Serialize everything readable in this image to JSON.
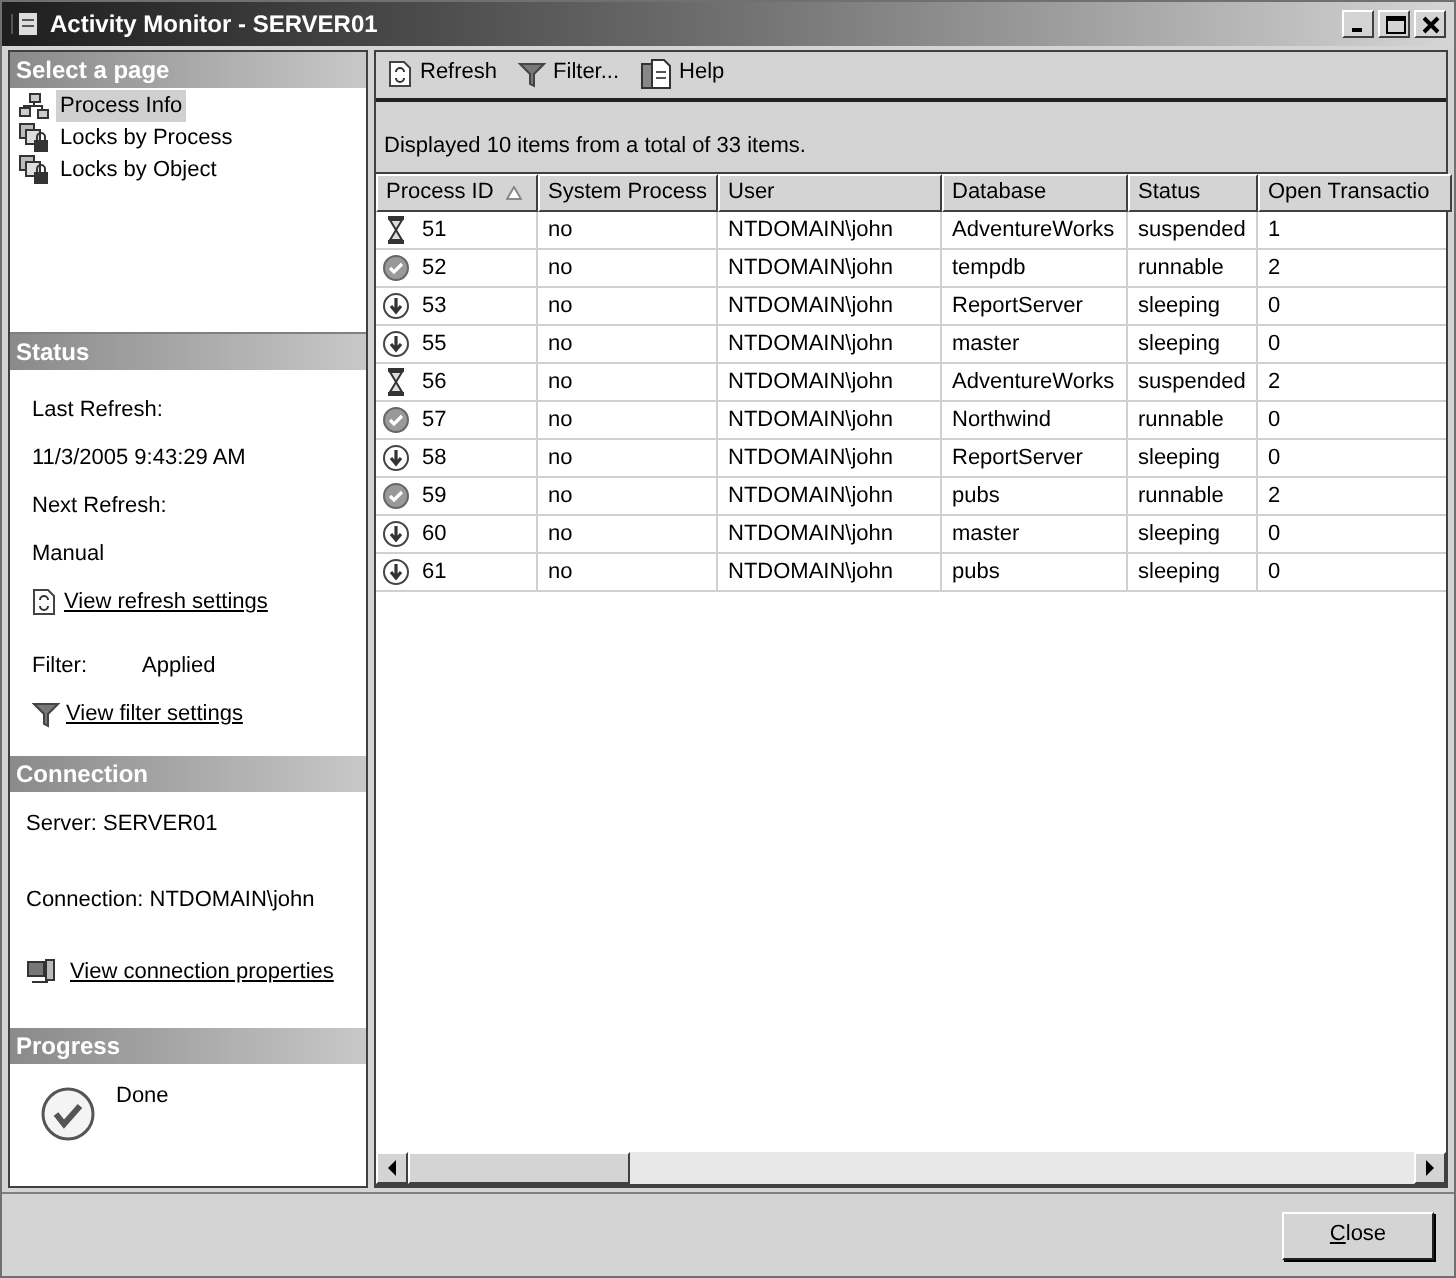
{
  "window": {
    "title": "Activity Monitor - SERVER01"
  },
  "select_page": {
    "title": "Select a page",
    "items": [
      {
        "label": "Process Info",
        "kind": "process",
        "selected": true
      },
      {
        "label": "Locks by Process",
        "kind": "locks",
        "selected": false
      },
      {
        "label": "Locks by Object",
        "kind": "locks",
        "selected": false
      }
    ]
  },
  "status": {
    "title": "Status",
    "last_refresh_label": "Last Refresh:",
    "last_refresh": "11/3/2005 9:43:29 AM",
    "next_refresh_label": "Next Refresh:",
    "next_refresh": "Manual",
    "refresh_link": "View refresh settings",
    "filter_label": "Filter:",
    "filter_value": "Applied",
    "filter_link": "View filter settings"
  },
  "connection": {
    "title": "Connection",
    "server": "Server: SERVER01",
    "connection": "Connection: NTDOMAIN\\john",
    "link": "View connection properties"
  },
  "progress": {
    "title": "Progress",
    "text": "Done"
  },
  "toolbar": [
    {
      "label": "Refresh",
      "kind": "refresh"
    },
    {
      "label": "Filter...",
      "kind": "filter"
    },
    {
      "label": "Help",
      "kind": "help"
    }
  ],
  "info": "Displayed 10 items from a total of 33 items.",
  "table": {
    "columns": [
      {
        "label": "Process ID",
        "sorted": true
      },
      {
        "label": "System Process",
        "sorted": false
      },
      {
        "label": "User",
        "sorted": false
      },
      {
        "label": "Database",
        "sorted": false
      },
      {
        "label": "Status",
        "sorted": false
      },
      {
        "label": "Open Transactio",
        "sorted": false
      }
    ],
    "rows": [
      {
        "kind": "suspended",
        "cells": [
          "51",
          "no",
          "NTDOMAIN\\john",
          "AdventureWorks",
          "suspended",
          "1"
        ]
      },
      {
        "kind": "runnable",
        "cells": [
          "52",
          "no",
          "NTDOMAIN\\john",
          "tempdb",
          "runnable",
          "2"
        ]
      },
      {
        "kind": "sleeping",
        "cells": [
          "53",
          "no",
          "NTDOMAIN\\john",
          "ReportServer",
          "sleeping",
          "0"
        ]
      },
      {
        "kind": "sleeping",
        "cells": [
          "55",
          "no",
          "NTDOMAIN\\john",
          "master",
          "sleeping",
          "0"
        ]
      },
      {
        "kind": "suspended",
        "cells": [
          "56",
          "no",
          "NTDOMAIN\\john",
          "AdventureWorks",
          "suspended",
          "2"
        ]
      },
      {
        "kind": "runnable",
        "cells": [
          "57",
          "no",
          "NTDOMAIN\\john",
          "Northwind",
          "runnable",
          "0"
        ]
      },
      {
        "kind": "sleeping",
        "cells": [
          "58",
          "no",
          "NTDOMAIN\\john",
          "ReportServer",
          "sleeping",
          "0"
        ]
      },
      {
        "kind": "runnable",
        "cells": [
          "59",
          "no",
          "NTDOMAIN\\john",
          "pubs",
          "runnable",
          "2"
        ]
      },
      {
        "kind": "sleeping",
        "cells": [
          "60",
          "no",
          "NTDOMAIN\\john",
          "master",
          "sleeping",
          "0"
        ]
      },
      {
        "kind": "sleeping",
        "cells": [
          "61",
          "no",
          "NTDOMAIN\\john",
          "pubs",
          "sleeping",
          "0"
        ]
      }
    ]
  },
  "buttons": [
    {
      "label": "Close"
    }
  ]
}
